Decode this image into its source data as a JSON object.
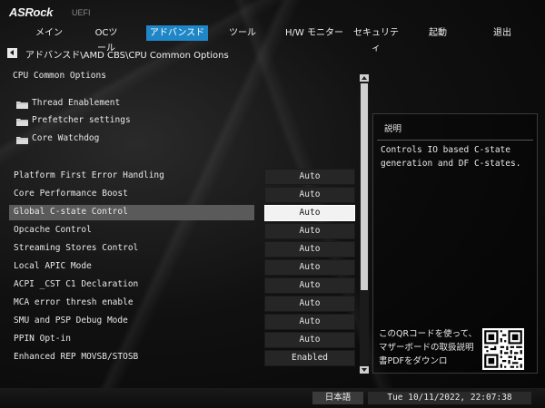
{
  "header": {
    "logo": "ASRock",
    "uefi_label": "UEFI",
    "tabs": [
      {
        "label": "メイン"
      },
      {
        "label": "OCツール"
      },
      {
        "label": "アドバンスド"
      },
      {
        "label": "ツール"
      },
      {
        "label": "H/W モニター"
      },
      {
        "label": "セキュリティ"
      },
      {
        "label": "起動"
      },
      {
        "label": "退出"
      }
    ],
    "active_tab": "アドバンスド"
  },
  "breadcrumb": "アドバンスド\\AMD CBS\\CPU Common Options",
  "section_title": "CPU Common Options",
  "folders": [
    {
      "label": "Thread Enablement",
      "icon": "folder-icon"
    },
    {
      "label": "Prefetcher settings",
      "icon": "folder-icon"
    },
    {
      "label": "Core Watchdog",
      "icon": "folder-icon"
    }
  ],
  "settings": [
    {
      "label": "Platform First Error Handling",
      "value": "Auto"
    },
    {
      "label": "Core Performance Boost",
      "value": "Auto"
    },
    {
      "label": "Global C-state Control",
      "value": "Auto",
      "selected": true
    },
    {
      "label": "Opcache Control",
      "value": "Auto"
    },
    {
      "label": "Streaming Stores Control",
      "value": "Auto"
    },
    {
      "label": "Local APIC Mode",
      "value": "Auto"
    },
    {
      "label": "ACPI _CST C1 Declaration",
      "value": "Auto"
    },
    {
      "label": "MCA error thresh enable",
      "value": "Auto"
    },
    {
      "label": "SMU and PSP Debug Mode",
      "value": "Auto"
    },
    {
      "label": "PPIN Opt-in",
      "value": "Auto"
    },
    {
      "label": "Enhanced REP MOVSB/STOSB",
      "value": "Enabled"
    }
  ],
  "description": {
    "title": "説明",
    "text": "Controls IO based C-state generation and DF C-states.",
    "qr_text": "このQRコードを使って、マザーボードの取扱説明書PDFをダウンロ"
  },
  "footer": {
    "language": "日本語",
    "datetime": "Tue 10/11/2022, 22:07:38"
  },
  "colors": {
    "active_tab": "#1f87c7",
    "selected_row": "#5a5a5a",
    "value_box": "#262626"
  }
}
